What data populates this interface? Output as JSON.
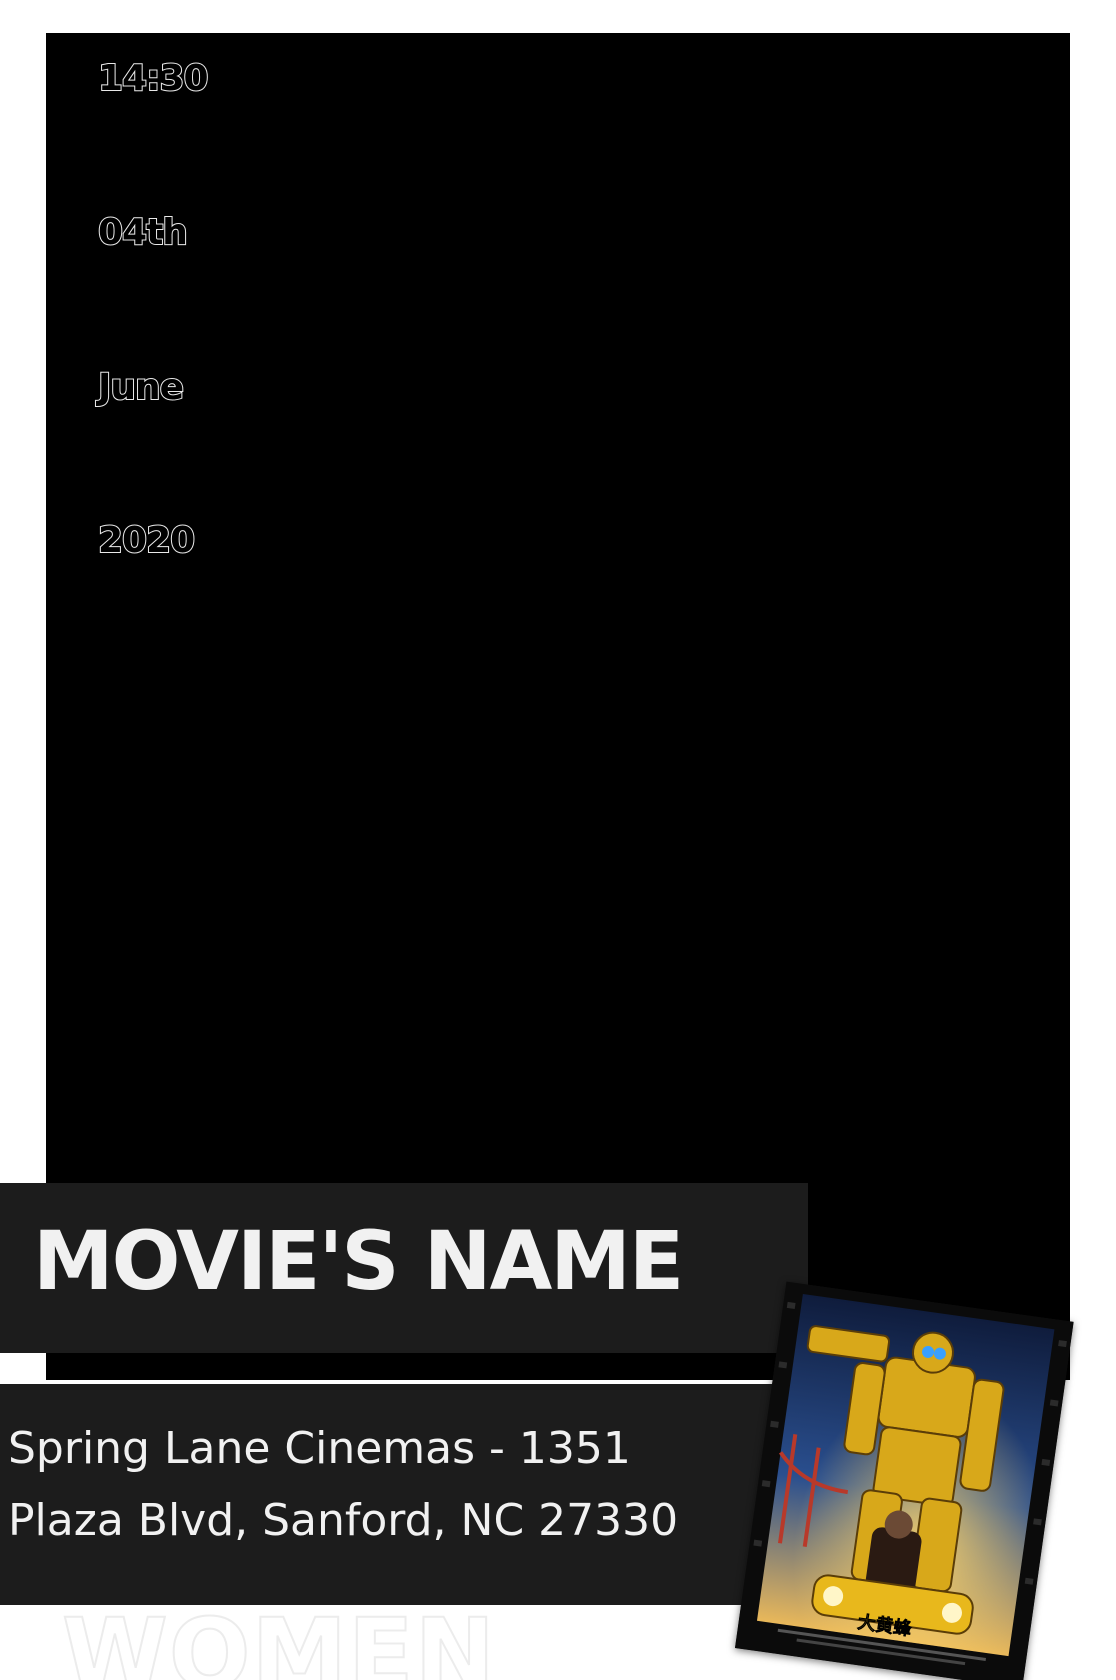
{
  "date": {
    "time": "14:30",
    "day": "04th",
    "month": "June",
    "year": "2020"
  },
  "title": "MOVIE'S NAME",
  "address": {
    "line1": "Spring Lane Cinemas - 1351",
    "line2": "Plaza Blvd, Sanford, NC 27330"
  },
  "watermark": "WOMEN",
  "poster": {
    "caption": "大黄蜂"
  },
  "colors": {
    "panel": "#000000",
    "band": "#1c1c1c",
    "text_light": "#f1f1f1",
    "poster_yellow": "#e8b81c",
    "poster_sky": "#1e3c78"
  }
}
